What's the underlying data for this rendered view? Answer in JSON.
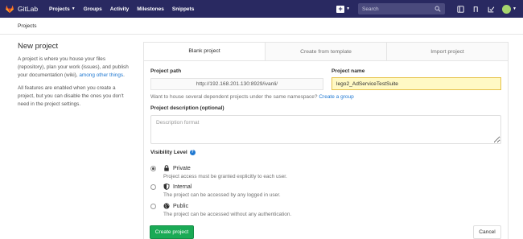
{
  "navbar": {
    "brand": "GitLab",
    "links": [
      {
        "label": "Projects",
        "dropdown": true
      },
      {
        "label": "Groups"
      },
      {
        "label": "Activity"
      },
      {
        "label": "Milestones"
      },
      {
        "label": "Snippets"
      }
    ],
    "search_placeholder": "Search",
    "icons": [
      "plus-icon",
      "search-icon",
      "sidebar-icon",
      "merge-request-icon",
      "todo-check-icon",
      "avatar"
    ],
    "colors": {
      "background": "#292961",
      "avatar": "#a6d56d"
    }
  },
  "breadcrumb": "Projects",
  "intro": {
    "title": "New project",
    "paragraph1_text": "A project is where you house your files (repository), plan your work (issues), and publish your documentation (wiki),",
    "paragraph1_link": "among other things",
    "paragraph1_end": ".",
    "paragraph2": "All features are enabled when you create a project, but you can disable the ones you don't need in the project settings."
  },
  "tabs": [
    {
      "label": "Blank project",
      "active": true
    },
    {
      "label": "Create from template",
      "active": false
    },
    {
      "label": "Import project",
      "active": false
    }
  ],
  "form": {
    "path_label": "Project path",
    "path_value": "http://192.168.201.130:8929/ivanli/",
    "name_label": "Project name",
    "name_value": "lego2_AdServiceTestSuite",
    "hint_text": "Want to house several dependent projects under the same namespace?",
    "hint_link": "Create a group",
    "description_label": "Project description (optional)",
    "description_placeholder": "Description format",
    "visibility_label": "Visibility Level",
    "visibility_options": [
      {
        "title": "Private",
        "desc": "Project access must be granted explicitly to each user.",
        "icon": "lock-icon",
        "checked": true
      },
      {
        "title": "Internal",
        "desc": "The project can be accessed by any logged in user.",
        "icon": "shield-icon",
        "checked": false
      },
      {
        "title": "Public",
        "desc": "The project can be accessed without any authentication.",
        "icon": "globe-icon",
        "checked": false
      }
    ],
    "create_button": "Create project",
    "cancel_button": "Cancel",
    "colors": {
      "primary_button": "#1aaa55",
      "link": "#1f78d1",
      "name_highlight": "#fff9c4"
    }
  }
}
